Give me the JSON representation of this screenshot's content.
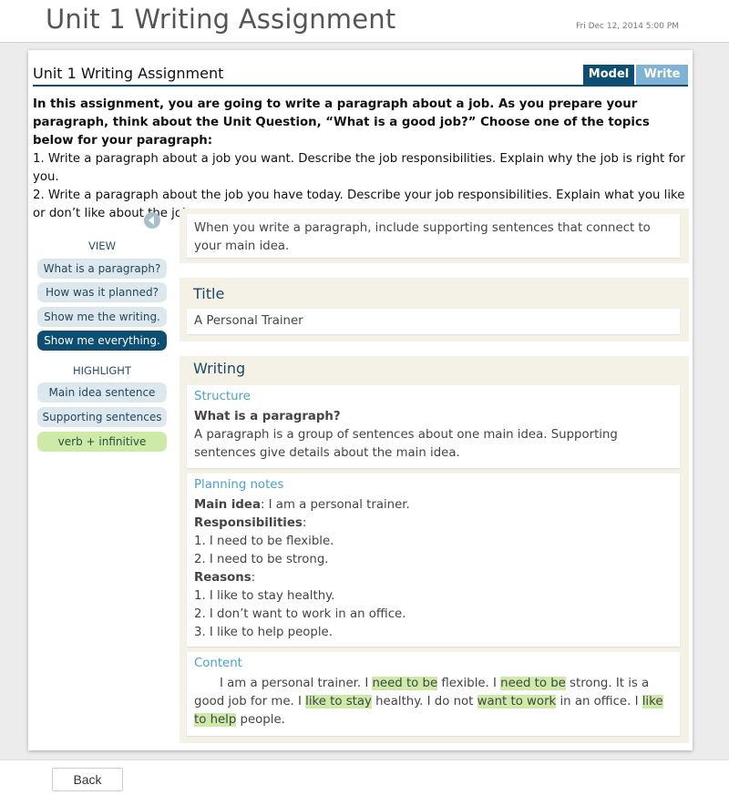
{
  "app": {
    "title": "Unit 1 Writing Assignment",
    "datetime": "Fri Dec 12, 2014 5:00 PM"
  },
  "card": {
    "title": "Unit 1 Writing Assignment",
    "tabs": [
      {
        "label": "Model",
        "active": true
      },
      {
        "label": "Write",
        "active": false
      }
    ],
    "instructions": {
      "bold_text": "In this assignment, you are going to write a paragraph about a job.  As you prepare your paragraph, think about the Unit Question, “What is a good job?”  Choose one of the topics below for your paragraph:",
      "topic_1": "1. Write a paragraph about a job you want.  Describe the job responsibilities.  Explain why the job is right for you.",
      "topic_2": "2. Write a paragraph about the job you have today.  Describe your job responsibilities.  Explain what you like or don’t like about the job."
    }
  },
  "sidebar": {
    "view_label": "VIEW",
    "view_buttons": [
      {
        "label": "What is a paragraph?"
      },
      {
        "label": "How was it planned?"
      },
      {
        "label": "Show me the writing."
      },
      {
        "label": "Show me everything."
      }
    ],
    "highlight_label": "HIGHLIGHT",
    "highlight_buttons": [
      {
        "label": "Main idea sentence"
      },
      {
        "label": "Supporting sentences"
      },
      {
        "label": "verb + infinitive"
      }
    ],
    "colors": {
      "active": "#0d4f72",
      "highlight_green": "#cdeaa9"
    }
  },
  "main": {
    "intro": "When you write a paragraph, include supporting sentences that connect to your main idea.",
    "title_section": {
      "heading": "Title",
      "value": "A Personal Trainer"
    },
    "writing_section": {
      "heading": "Writing",
      "structure": {
        "label": "Structure",
        "question": "What is a paragraph?",
        "answer": "A paragraph is a group of sentences about one main idea.  Supporting sentences give details about the main idea."
      },
      "planning": {
        "label": "Planning notes",
        "main_idea_label": "Main idea",
        "main_idea_value": ": I am a personal trainer.",
        "responsibilities_label": "Responsibilities",
        "colon": ":",
        "responsibilities": [
          "1. I need to be flexible.",
          "2. I need to be strong."
        ],
        "reasons_label": "Reasons",
        "reasons": [
          "1. I like to stay healthy.",
          "2. I don’t want to work in an office.",
          "3. I like to help people."
        ]
      },
      "content": {
        "label": "Content",
        "segments": [
          {
            "text": "I am a personal trainer.  I ",
            "hl": false
          },
          {
            "text": "need to be",
            "hl": true
          },
          {
            "text": " flexible.  I ",
            "hl": false
          },
          {
            "text": "need to be",
            "hl": true
          },
          {
            "text": " strong.  It is a good job for me.  I ",
            "hl": false
          },
          {
            "text": "like to stay",
            "hl": true
          },
          {
            "text": " healthy.  I do not ",
            "hl": false
          },
          {
            "text": "want to work",
            "hl": true
          },
          {
            "text": " in an office. I ",
            "hl": false
          },
          {
            "text": "like to help",
            "hl": true
          },
          {
            "text": " people.",
            "hl": false
          }
        ]
      }
    }
  },
  "footer": {
    "back_label": "Back"
  }
}
